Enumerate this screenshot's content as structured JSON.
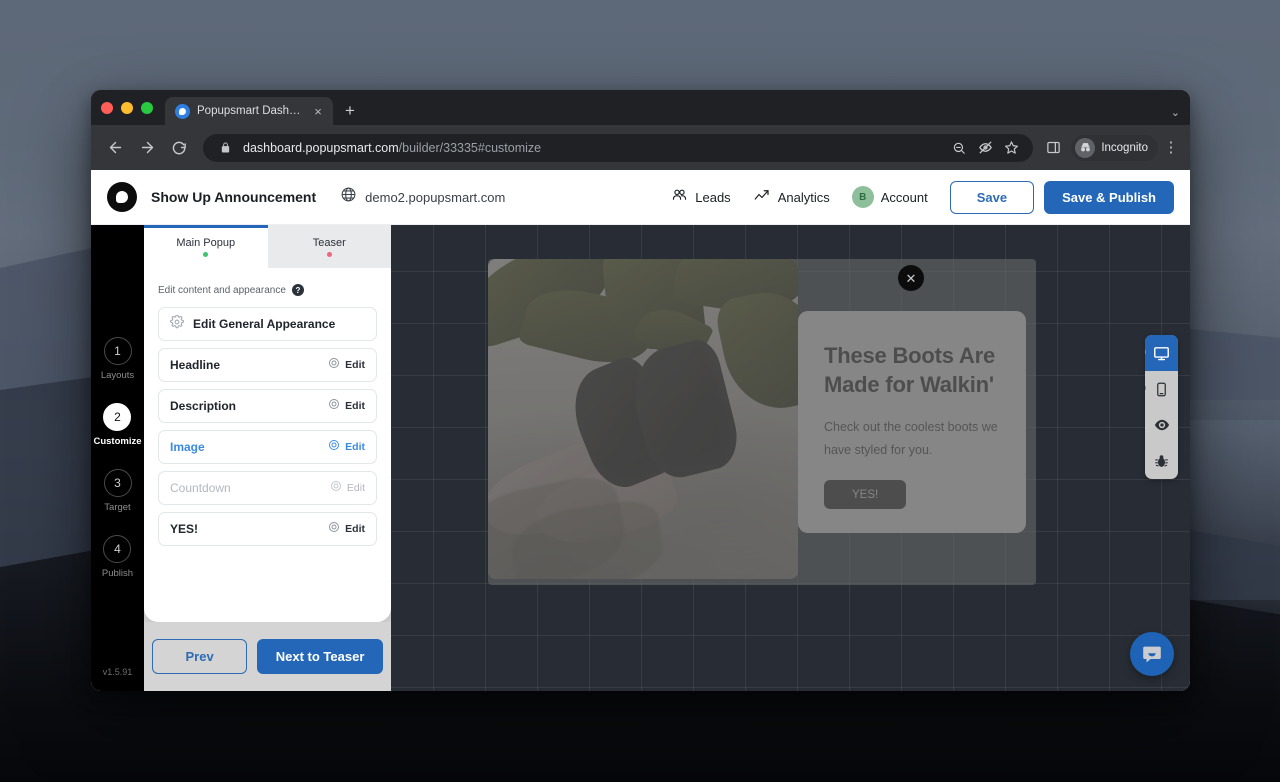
{
  "browser": {
    "tab": {
      "title": "Popupsmart Dashboard",
      "close_label": "×",
      "favicon": "popupsmart-favicon"
    },
    "new_tab_label": "+",
    "window_chevron": "⌄",
    "back_label": "←",
    "forward_label": "→",
    "reload_label": "↻",
    "url_domain": "dashboard.popupsmart.com",
    "url_path": "/builder/33335#customize",
    "lock_icon": "lock-icon",
    "zoom_icon": "search-zoom-icon",
    "tracking_icon": "eye-off-icon",
    "bookmark_icon": "star-icon",
    "sidepanel_icon": "side-panel-icon",
    "profile_label": "Incognito",
    "menu_label": "⋮"
  },
  "header": {
    "logo": "popupsmart-logo",
    "project_title": "Show Up Announcement",
    "globe_icon": "globe-icon",
    "domain": "demo2.popupsmart.com",
    "nav": [
      {
        "label": "Leads",
        "icon": "leads-icon"
      },
      {
        "label": "Analytics",
        "icon": "analytics-icon"
      }
    ],
    "account": {
      "label": "Account",
      "initial": "B",
      "avatar_color": "#8fbe9b"
    },
    "save_label": "Save",
    "publish_label": "Save & Publish",
    "accent_color": "#2467b8"
  },
  "rail": {
    "steps": [
      {
        "number": "1",
        "label": "Layouts",
        "active": false
      },
      {
        "number": "2",
        "label": "Customize",
        "active": true
      },
      {
        "number": "3",
        "label": "Target",
        "active": false
      },
      {
        "number": "4",
        "label": "Publish",
        "active": false
      }
    ],
    "version": "v1.5.91"
  },
  "panel": {
    "tabs": [
      {
        "label": "Main Popup",
        "dot": "green",
        "active": true
      },
      {
        "label": "Teaser",
        "dot": "red",
        "active": false
      }
    ],
    "section_title": "Edit content and appearance",
    "help_badge": "?",
    "general_row": {
      "label": "Edit General Appearance",
      "icon": "gear-icon"
    },
    "rows": [
      {
        "label": "Headline",
        "edit": "Edit",
        "state": "normal"
      },
      {
        "label": "Description",
        "edit": "Edit",
        "state": "normal"
      },
      {
        "label": "Image",
        "edit": "Edit",
        "state": "selected"
      },
      {
        "label": "Countdown",
        "edit": "Edit",
        "state": "disabled"
      },
      {
        "label": "YES!",
        "edit": "Edit",
        "state": "normal"
      }
    ],
    "prev_label": "Prev",
    "next_label": "Next to Teaser"
  },
  "preview": {
    "close_label": "✕",
    "headline": "These Boots Are Made for Walkin'",
    "description": "Check out the coolest boots we have styled for you.",
    "cta_label": "YES!",
    "image_alt": "black-boots-photo"
  },
  "devbar": {
    "buttons": [
      {
        "icon": "desktop-icon",
        "active": true,
        "dot": "green"
      },
      {
        "icon": "mobile-icon",
        "active": false,
        "dot": "red"
      },
      {
        "icon": "eye-preview-icon",
        "active": false,
        "dot": "none"
      },
      {
        "icon": "bug-debug-icon",
        "active": false,
        "dot": "none"
      }
    ]
  },
  "intercom": {
    "icon": "chat-bubble-icon",
    "color": "#1e63b5"
  }
}
